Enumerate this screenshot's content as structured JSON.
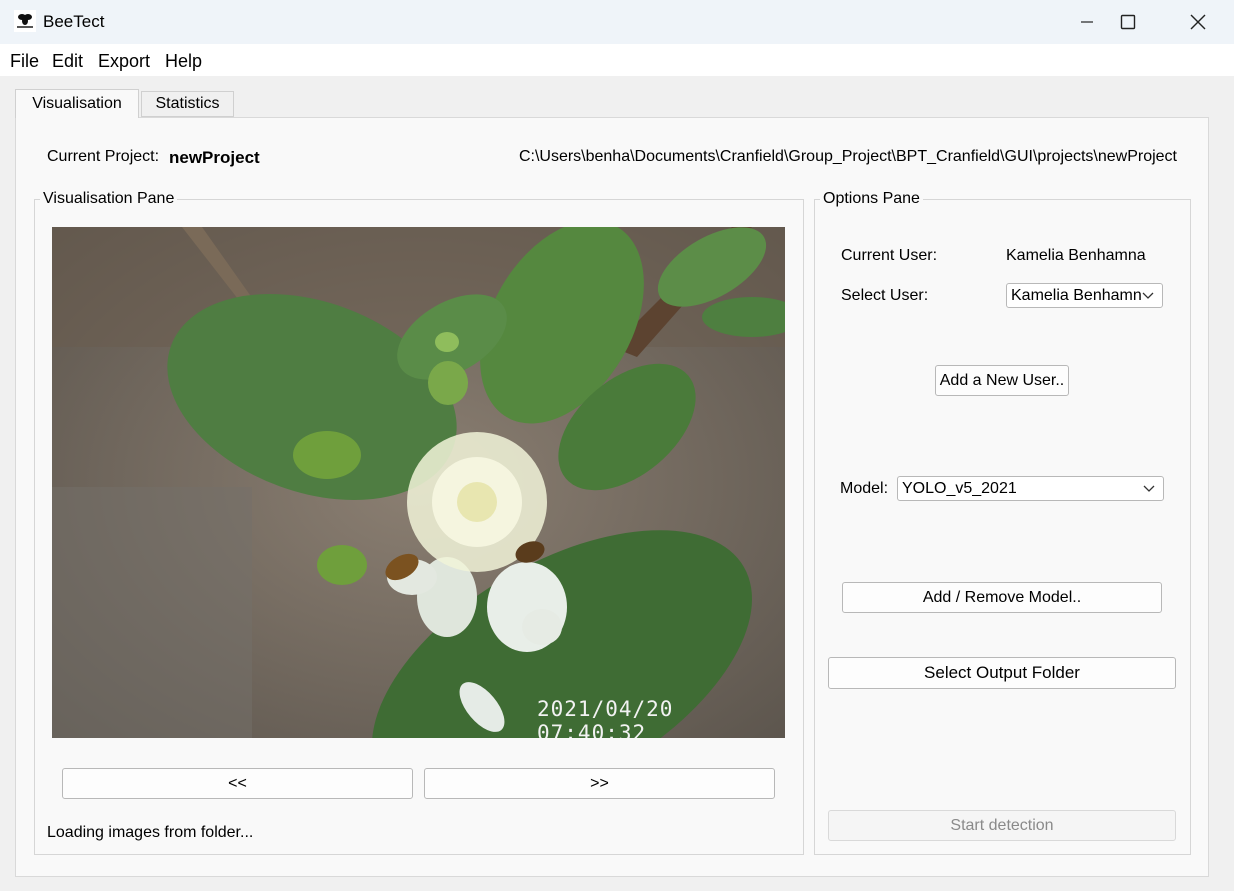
{
  "window": {
    "title": "BeeTect",
    "icon": "bee-logo-icon",
    "controls": [
      "minimize-icon",
      "maximize-icon",
      "close-icon"
    ]
  },
  "menu": {
    "items": [
      "File",
      "Edit",
      "Export",
      "Help"
    ]
  },
  "tabs": [
    {
      "label": "Visualisation",
      "active": true
    },
    {
      "label": "Statistics",
      "active": false
    }
  ],
  "project": {
    "label": "Current Project:",
    "name": "newProject",
    "path": "C:\\Users\\benha\\Documents\\Cranfield\\Group_Project\\BPT_Cranfield\\GUI\\projects\\newProject"
  },
  "visualisation": {
    "title": "Visualisation Pane",
    "image_timestamp": "2021/04/20 07:40:32",
    "prev_label": "<<",
    "next_label": ">>",
    "status": "Loading images from folder..."
  },
  "options": {
    "title": "Options Pane",
    "current_user_label": "Current User:",
    "current_user_value": "Kamelia Benhamna",
    "select_user_label": "Select User:",
    "select_user_value": "Kamelia Benhamn",
    "add_user_label": "Add a New User..",
    "model_label": "Model:",
    "model_value": "YOLO_v5_2021",
    "add_remove_model_label": "Add / Remove Model..",
    "select_output_label": "Select Output Folder",
    "start_detection_label": "Start detection"
  },
  "colors": {
    "titlebar_bg": "#eff4f9",
    "disabled_text": "#8a8a8a"
  }
}
